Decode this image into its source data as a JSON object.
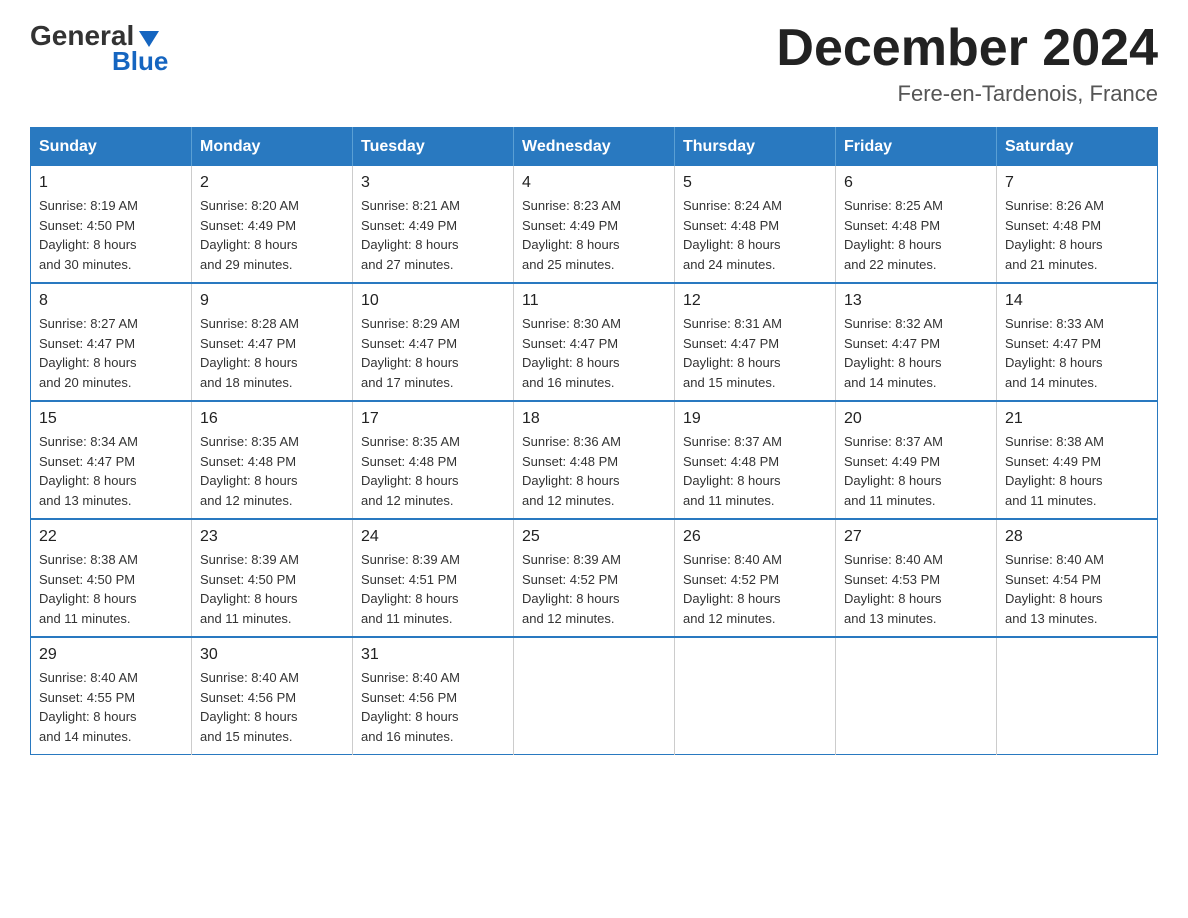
{
  "logo": {
    "general": "General",
    "blue": "Blue",
    "subtitle": "Blue"
  },
  "title": "December 2024",
  "subtitle": "Fere-en-Tardenois, France",
  "days_of_week": [
    "Sunday",
    "Monday",
    "Tuesday",
    "Wednesday",
    "Thursday",
    "Friday",
    "Saturday"
  ],
  "weeks": [
    [
      {
        "day": "1",
        "sunrise": "8:19 AM",
        "sunset": "4:50 PM",
        "daylight": "8 hours and 30 minutes."
      },
      {
        "day": "2",
        "sunrise": "8:20 AM",
        "sunset": "4:49 PM",
        "daylight": "8 hours and 29 minutes."
      },
      {
        "day": "3",
        "sunrise": "8:21 AM",
        "sunset": "4:49 PM",
        "daylight": "8 hours and 27 minutes."
      },
      {
        "day": "4",
        "sunrise": "8:23 AM",
        "sunset": "4:49 PM",
        "daylight": "8 hours and 25 minutes."
      },
      {
        "day": "5",
        "sunrise": "8:24 AM",
        "sunset": "4:48 PM",
        "daylight": "8 hours and 24 minutes."
      },
      {
        "day": "6",
        "sunrise": "8:25 AM",
        "sunset": "4:48 PM",
        "daylight": "8 hours and 22 minutes."
      },
      {
        "day": "7",
        "sunrise": "8:26 AM",
        "sunset": "4:48 PM",
        "daylight": "8 hours and 21 minutes."
      }
    ],
    [
      {
        "day": "8",
        "sunrise": "8:27 AM",
        "sunset": "4:47 PM",
        "daylight": "8 hours and 20 minutes."
      },
      {
        "day": "9",
        "sunrise": "8:28 AM",
        "sunset": "4:47 PM",
        "daylight": "8 hours and 18 minutes."
      },
      {
        "day": "10",
        "sunrise": "8:29 AM",
        "sunset": "4:47 PM",
        "daylight": "8 hours and 17 minutes."
      },
      {
        "day": "11",
        "sunrise": "8:30 AM",
        "sunset": "4:47 PM",
        "daylight": "8 hours and 16 minutes."
      },
      {
        "day": "12",
        "sunrise": "8:31 AM",
        "sunset": "4:47 PM",
        "daylight": "8 hours and 15 minutes."
      },
      {
        "day": "13",
        "sunrise": "8:32 AM",
        "sunset": "4:47 PM",
        "daylight": "8 hours and 14 minutes."
      },
      {
        "day": "14",
        "sunrise": "8:33 AM",
        "sunset": "4:47 PM",
        "daylight": "8 hours and 14 minutes."
      }
    ],
    [
      {
        "day": "15",
        "sunrise": "8:34 AM",
        "sunset": "4:47 PM",
        "daylight": "8 hours and 13 minutes."
      },
      {
        "day": "16",
        "sunrise": "8:35 AM",
        "sunset": "4:48 PM",
        "daylight": "8 hours and 12 minutes."
      },
      {
        "day": "17",
        "sunrise": "8:35 AM",
        "sunset": "4:48 PM",
        "daylight": "8 hours and 12 minutes."
      },
      {
        "day": "18",
        "sunrise": "8:36 AM",
        "sunset": "4:48 PM",
        "daylight": "8 hours and 12 minutes."
      },
      {
        "day": "19",
        "sunrise": "8:37 AM",
        "sunset": "4:48 PM",
        "daylight": "8 hours and 11 minutes."
      },
      {
        "day": "20",
        "sunrise": "8:37 AM",
        "sunset": "4:49 PM",
        "daylight": "8 hours and 11 minutes."
      },
      {
        "day": "21",
        "sunrise": "8:38 AM",
        "sunset": "4:49 PM",
        "daylight": "8 hours and 11 minutes."
      }
    ],
    [
      {
        "day": "22",
        "sunrise": "8:38 AM",
        "sunset": "4:50 PM",
        "daylight": "8 hours and 11 minutes."
      },
      {
        "day": "23",
        "sunrise": "8:39 AM",
        "sunset": "4:50 PM",
        "daylight": "8 hours and 11 minutes."
      },
      {
        "day": "24",
        "sunrise": "8:39 AM",
        "sunset": "4:51 PM",
        "daylight": "8 hours and 11 minutes."
      },
      {
        "day": "25",
        "sunrise": "8:39 AM",
        "sunset": "4:52 PM",
        "daylight": "8 hours and 12 minutes."
      },
      {
        "day": "26",
        "sunrise": "8:40 AM",
        "sunset": "4:52 PM",
        "daylight": "8 hours and 12 minutes."
      },
      {
        "day": "27",
        "sunrise": "8:40 AM",
        "sunset": "4:53 PM",
        "daylight": "8 hours and 13 minutes."
      },
      {
        "day": "28",
        "sunrise": "8:40 AM",
        "sunset": "4:54 PM",
        "daylight": "8 hours and 13 minutes."
      }
    ],
    [
      {
        "day": "29",
        "sunrise": "8:40 AM",
        "sunset": "4:55 PM",
        "daylight": "8 hours and 14 minutes."
      },
      {
        "day": "30",
        "sunrise": "8:40 AM",
        "sunset": "4:56 PM",
        "daylight": "8 hours and 15 minutes."
      },
      {
        "day": "31",
        "sunrise": "8:40 AM",
        "sunset": "4:56 PM",
        "daylight": "8 hours and 16 minutes."
      },
      null,
      null,
      null,
      null
    ]
  ],
  "labels": {
    "sunrise": "Sunrise:",
    "sunset": "Sunset:",
    "daylight": "Daylight:"
  }
}
